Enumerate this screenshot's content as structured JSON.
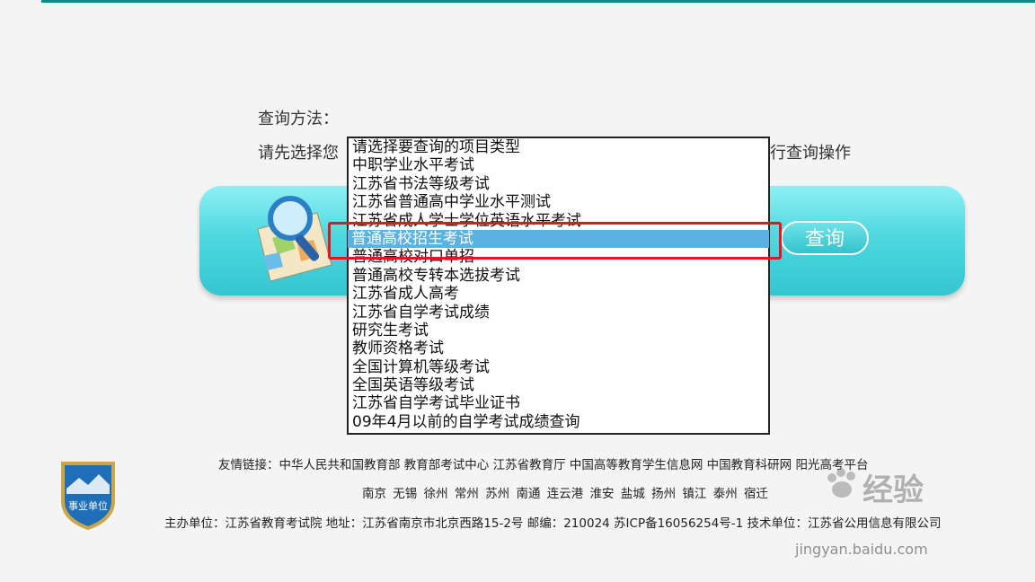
{
  "method": {
    "title": "查询方法：",
    "line_left": "请先选择您",
    "line_right": "行查询操作"
  },
  "search": {
    "query_button": "查询"
  },
  "dropdown": {
    "options": [
      "请选择要查询的项目类型",
      "中职学业水平考试",
      "江苏省书法等级考试",
      "江苏省普通高中学业水平测试",
      "江苏省成人学士学位英语水平考试",
      "普通高校招生考试",
      "普通高校对口单招",
      "普通高校专转本选拔考试",
      "江苏省成人高考",
      "江苏省自学考试成绩",
      "研究生考试",
      "教师资格考试",
      "全国计算机等级考试",
      "全国英语等级考试",
      "江苏省自学考试毕业证书",
      "09年4月以前的自学考试成绩查询"
    ],
    "selected": "普通高校招生考试"
  },
  "footer": {
    "links": "友情链接：中华人民共和国教育部  教育部考试中心  江苏省教育厅  中国高等教育学生信息网  中国教育科研网  阳光高考平台",
    "cities": "南京 无锡 徐州 常州 苏州 南通 连云港 淮安 盐城 扬州 镇江 泰州 宿迁",
    "info": "主办单位：江苏省教育考试院  地址：江苏省南京市北京西路15-2号  邮编：210024  苏ICP备16056254号-1  技术单位：江苏省公用信息有限公司",
    "badge_text": "事业单位"
  },
  "watermark": {
    "text": "经验",
    "url": "jingyan.baidu.com"
  },
  "colors": {
    "accent": "#0e8a84",
    "banner": "#4fd8e0",
    "selected_option": "#5ab2e0",
    "highlight": "#e8141c"
  }
}
